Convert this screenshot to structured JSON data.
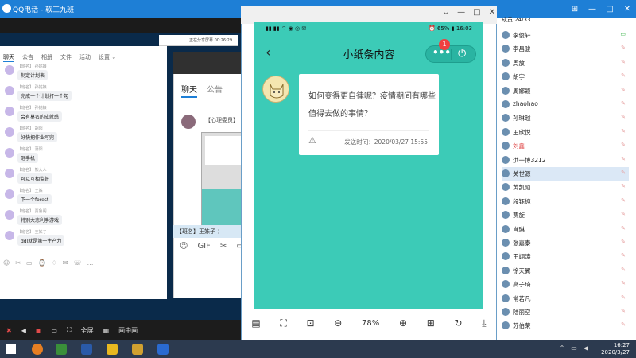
{
  "qq_bar": {
    "title": "QQ电话 - 软工九班",
    "controls": [
      "⊞",
      "—",
      "□",
      "✕"
    ]
  },
  "share_bar": {
    "text": "正在分享屏幕    00:26:29"
  },
  "left_chat": {
    "tabs": [
      "聊天",
      "公告",
      "相册",
      "文件",
      "活动",
      "设置 ⌄"
    ],
    "messages": [
      {
        "name": "【班名】 孙姑娘",
        "text": "制定计划表"
      },
      {
        "name": "【班名】 孙姑娘",
        "text": "完成一个计划打一个勾"
      },
      {
        "name": "【班名】 孙姑娘",
        "text": "会有莫名的成就感"
      },
      {
        "name": "【班名】 胡阳",
        "text": "好快把作业写完"
      },
      {
        "name": "【班名】 蒲阳",
        "text": "砸手机"
      },
      {
        "name": "【班名】 熊大人",
        "text": "可以互相监督"
      },
      {
        "name": "【班名】 王姝",
        "text": "下一个forest"
      },
      {
        "name": "【班名】 贾鲁阁",
        "text": "特别大悲利手游戏"
      },
      {
        "name": "【班名】 王姝子",
        "text": "ddl就是第一生产力"
      }
    ],
    "toolbar_icons": [
      "☺",
      "✂",
      "▭",
      "⌚",
      "♢",
      "✉",
      "☏",
      "…"
    ]
  },
  "mid_window": {
    "tabs": [
      "聊天",
      "公告"
    ],
    "member_text": "【心理委员】",
    "bottom_text": "【班名】王姝子 ：",
    "tool_icons": [
      "☺",
      "GIF",
      "✂",
      "▭"
    ]
  },
  "phone": {
    "status_left": "▮▮ ▮▮ ⌔ ◉ ◎ ✉",
    "status_right": "⏰ 65% ▮ 16:03",
    "app_title": "小纸条内容",
    "badge": "1",
    "question": "如何变得更自律呢？疫情期间有哪些值得去做的事情？",
    "time_label": "发送时间：2020/03/27 15:55",
    "zoom": "78%"
  },
  "members": {
    "header": "成员 24/33",
    "list": [
      "李俊轩",
      "李昌骏",
      "周放",
      "胡宇",
      "周娜颖",
      "zhaohao",
      "孙琳越",
      "王欣悦",
      "刘鑫",
      "洪一博3212",
      "关世源",
      "黄凯勋",
      "段钰纯",
      "贾旋",
      "肖琳",
      "张嘉泰",
      "王翊涛",
      "徐天翼",
      "高子琦",
      "常若凡",
      "陆丽空",
      "苏伯荣"
    ]
  },
  "left_bottom": {
    "fullscreen": "全屏",
    "pip": "画中画"
  },
  "taskbar": {
    "time": "16:27",
    "date": "2020/3/27"
  }
}
